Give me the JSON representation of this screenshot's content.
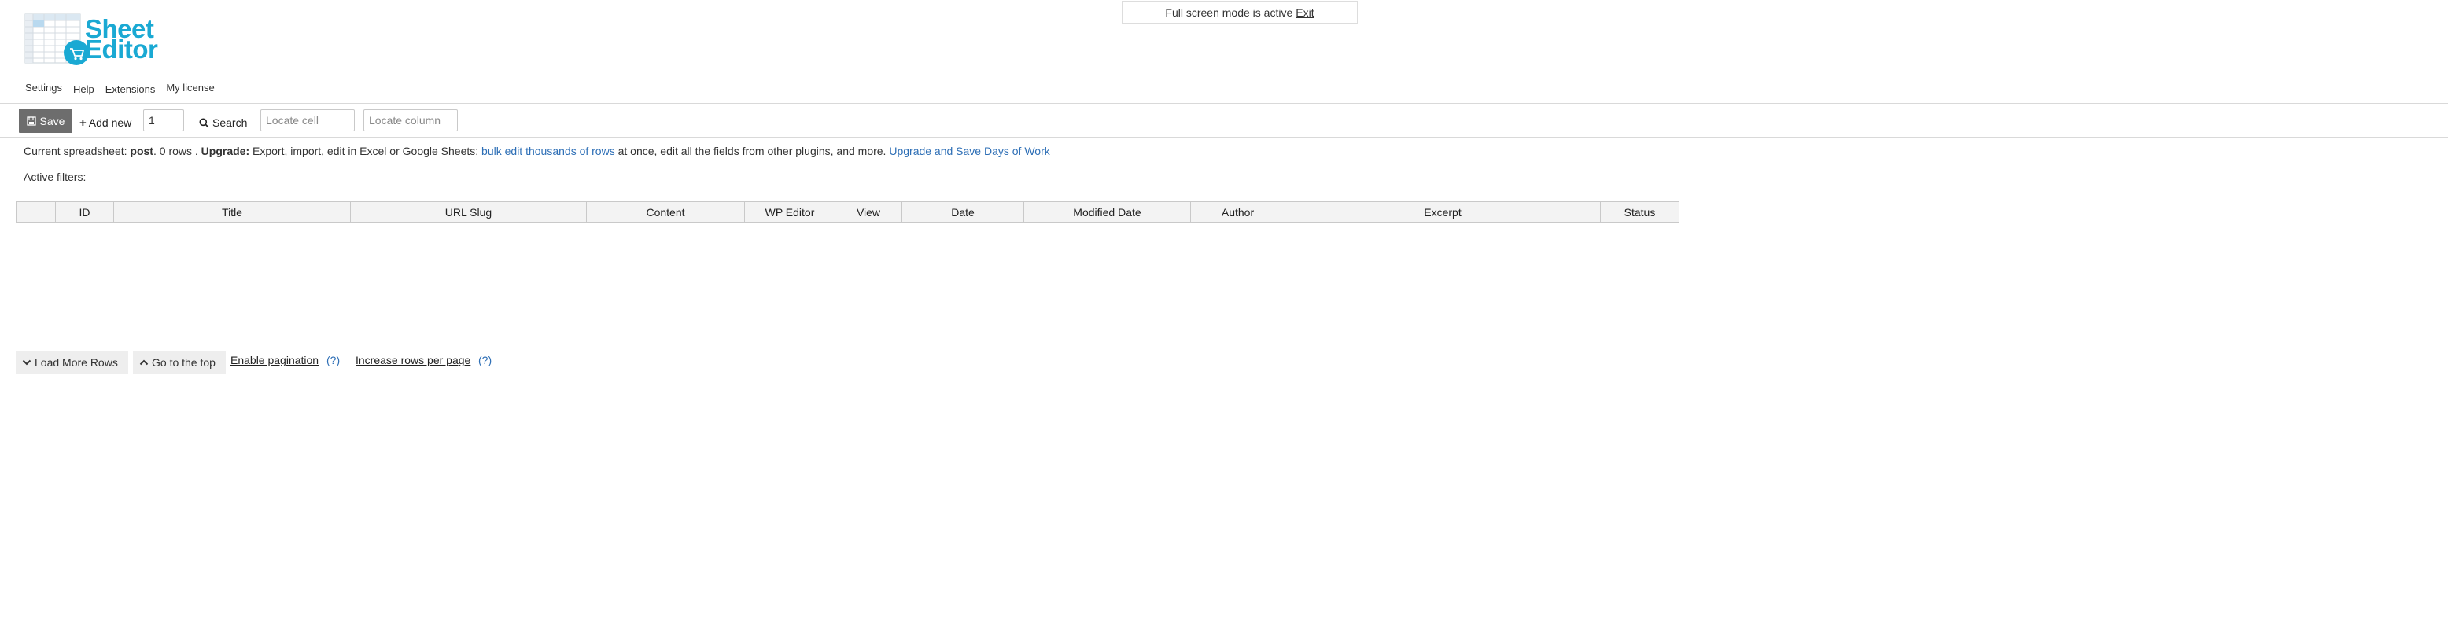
{
  "fullscreen_notice": {
    "text": "Full screen mode is active",
    "exit_label": "Exit"
  },
  "logo": {
    "line1": "Sheet",
    "line2": "Editor",
    "brand_color": "#1aa9d3"
  },
  "menu": {
    "items": [
      "Settings",
      "Help",
      "Extensions",
      "My license"
    ]
  },
  "toolbar": {
    "save_label": "Save",
    "add_new_label": "Add new",
    "add_new_count": "1",
    "search_label": "Search",
    "locate_cell_placeholder": "Locate cell",
    "locate_column_placeholder": "Locate column"
  },
  "info": {
    "prefix": "Current spreadsheet:",
    "post_type": "post",
    "rows_text": ". 0 rows .",
    "upgrade_label": "Upgrade:",
    "upgrade_text": "Export, import, edit in Excel or Google Sheets;",
    "bulk_link": "bulk edit thousands of rows",
    "middle_text": "at once, edit all the fields from other plugins, and more.",
    "save_link": "Upgrade and Save Days of Work"
  },
  "filters": {
    "label": "Active filters:"
  },
  "grid": {
    "columns": [
      "",
      "ID",
      "Title",
      "URL Slug",
      "Content",
      "WP Editor",
      "View",
      "Date",
      "Modified Date",
      "Author",
      "Excerpt",
      "Status"
    ]
  },
  "bottom": {
    "load_more_label": "Load More Rows",
    "go_top_label": "Go to the top",
    "enable_pagination_label": "Enable pagination",
    "help_1": "(?)",
    "increase_rows_label": "Increase rows per page",
    "help_2": "(?)"
  },
  "colors": {
    "accent": "#1aa9d3",
    "link": "#2e6fb6",
    "save_bg": "#6d6d6d"
  }
}
